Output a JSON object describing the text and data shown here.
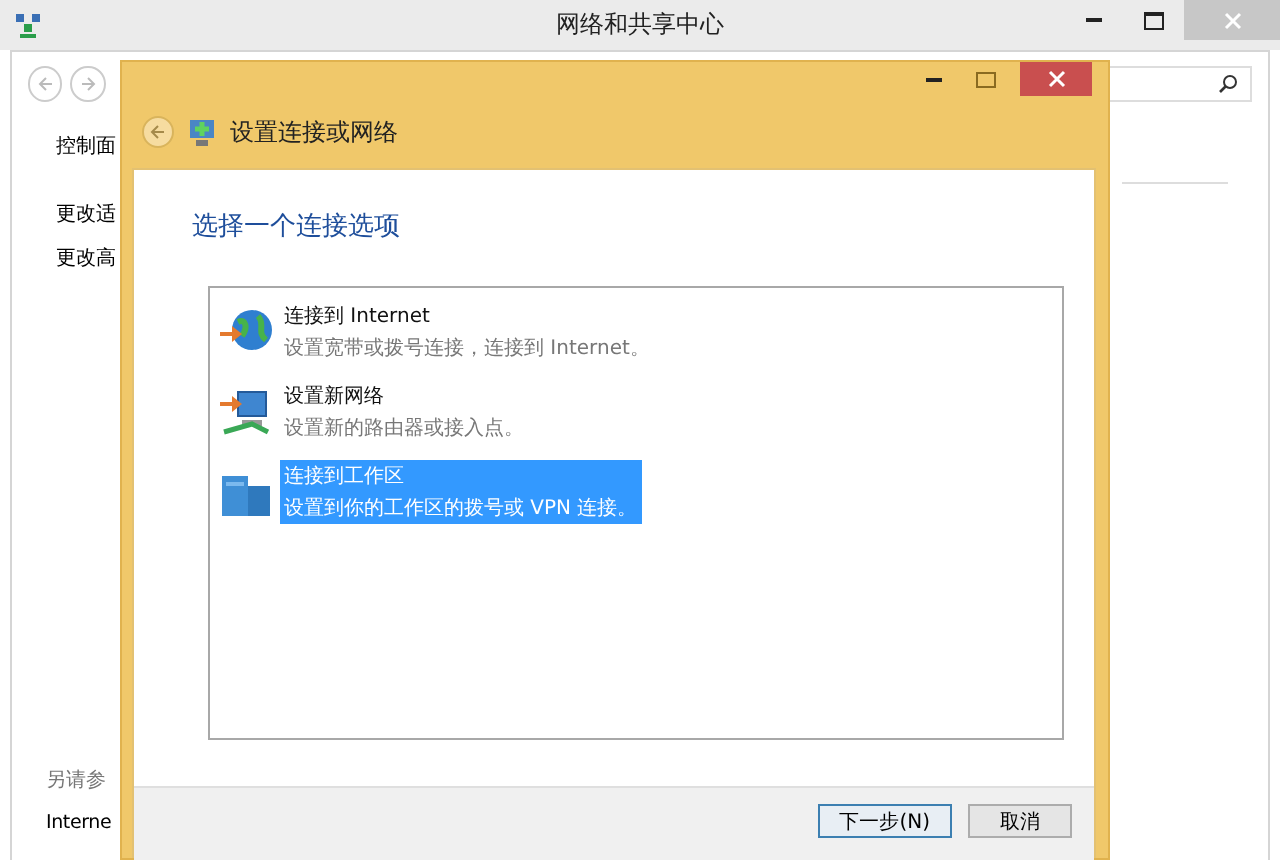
{
  "background_window": {
    "title": "网络和共享中心",
    "sidebar": [
      {
        "label": "控制面"
      },
      {
        "label": "更改适"
      },
      {
        "label": "更改高"
      }
    ],
    "see_also": {
      "heading": "另请参",
      "links": [
        {
          "label": "Interne"
        }
      ]
    }
  },
  "dialog": {
    "title": "设置连接或网络",
    "heading": "选择一个连接选项",
    "options": [
      {
        "kind": "internet",
        "title": "连接到 Internet",
        "description": "设置宽带或拨号连接，连接到 Internet。",
        "selected": false
      },
      {
        "kind": "network",
        "title": "设置新网络",
        "description": "设置新的路由器或接入点。",
        "selected": false
      },
      {
        "kind": "workplace",
        "title": "连接到工作区",
        "description": "设置到你的工作区的拨号或 VPN 连接。",
        "selected": true
      }
    ],
    "buttons": [
      {
        "label": "下一步(N)",
        "default": true
      },
      {
        "label": "取消",
        "default": false
      }
    ]
  }
}
